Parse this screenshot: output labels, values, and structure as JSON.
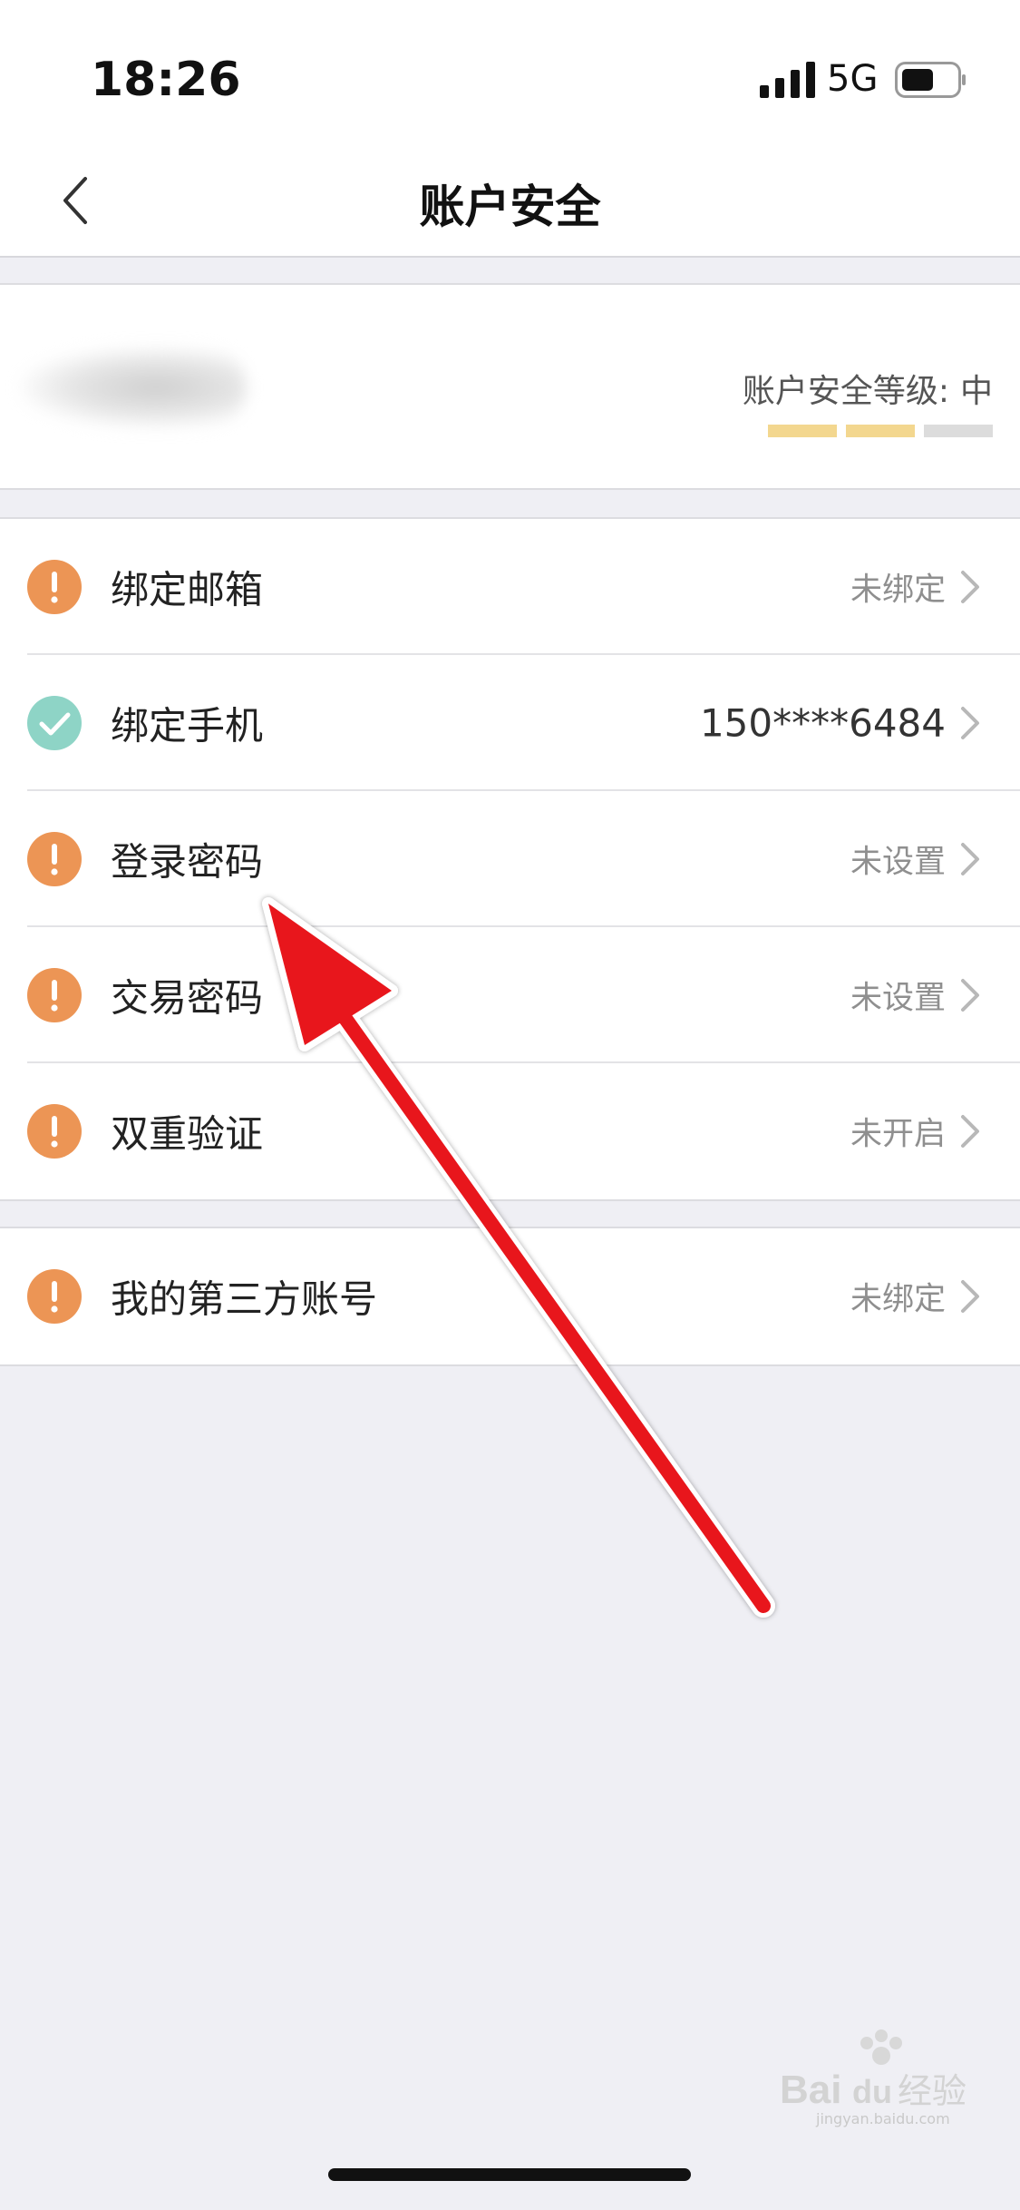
{
  "status_bar": {
    "time": "18:26",
    "network": "5G",
    "signal_icon": "cellular-signal-icon",
    "battery_icon": "battery-icon"
  },
  "nav": {
    "title": "账户安全",
    "back_icon": "chevron-left-icon"
  },
  "security_level": {
    "label": "账户安全等级:",
    "value": "中",
    "filled_segments": 2,
    "total_segments": 3,
    "filled_color": "#f3d78f",
    "empty_color": "#dcdcdc"
  },
  "groups": [
    {
      "items": [
        {
          "label": "绑定邮箱",
          "value": "未绑定",
          "status": "warning"
        },
        {
          "label": "绑定手机",
          "value": "150****6484",
          "status": "ok"
        },
        {
          "label": "登录密码",
          "value": "未设置",
          "status": "warning"
        },
        {
          "label": "交易密码",
          "value": "未设置",
          "status": "warning"
        },
        {
          "label": "双重验证",
          "value": "未开启",
          "status": "warning"
        }
      ]
    },
    {
      "items": [
        {
          "label": "我的第三方账号",
          "value": "未绑定",
          "status": "warning"
        }
      ]
    }
  ],
  "colors": {
    "warning": "#ec9555",
    "ok": "#8ed4c6",
    "annotation_arrow": "#e8141b",
    "background": "#efeff4"
  },
  "watermark": {
    "brand": "Bai",
    "brand_suffix": "du",
    "name": "经验",
    "domain": "jingyan.baidu.com"
  }
}
